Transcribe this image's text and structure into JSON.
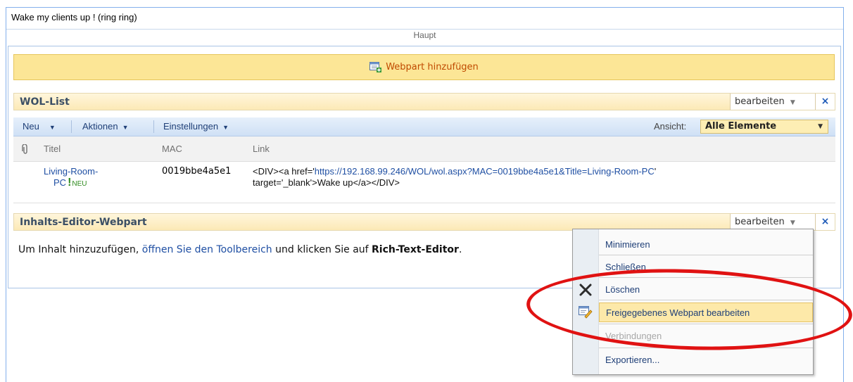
{
  "page": {
    "title": "Wake my clients up ! (ring ring)",
    "zone_label": "Haupt",
    "add_webpart_label": "Webpart hinzufügen"
  },
  "wol_list": {
    "title": "WOL-List",
    "edit_label": "bearbeiten",
    "close_label": "×",
    "toolbar": {
      "new_label": "Neu",
      "actions_label": "Aktionen",
      "settings_label": "Einstellungen",
      "view_label": "Ansicht:",
      "view_value": "Alle Elemente"
    },
    "columns": [
      "Titel",
      "MAC",
      "Link"
    ],
    "rows": [
      {
        "title_line1": "Living-Room-",
        "title_line2": "PC",
        "new_badge": "NEU",
        "mac": "0019bbe4a5e1",
        "link_pre": "<DIV><a href='",
        "link_url": "https://192.168.99.246/WOL/wol.aspx?MAC=0019bbe4a5e1&Title=Living-Room-PC",
        "link_post": "'",
        "link_line2": "target='_blank'>Wake up</a></DIV>"
      }
    ]
  },
  "content_editor": {
    "title": "Inhalts-Editor-Webpart",
    "edit_label": "bearbeiten",
    "close_label": "×",
    "text_before": "Um Inhalt hinzuzufügen, ",
    "link_text": "öffnen Sie den Toolbereich",
    "text_middle": " und klicken Sie auf ",
    "bold_text": "Rich-Text-Editor",
    "text_after": "."
  },
  "context_menu": {
    "items": [
      {
        "label": "Minimieren",
        "disabled": false
      },
      {
        "label": "Schließen",
        "disabled": false
      },
      {
        "label": "Löschen",
        "disabled": false,
        "icon": "delete-x-icon"
      },
      {
        "label": "Freigegebenes Webpart bearbeiten",
        "disabled": false,
        "highlighted": true,
        "icon": "edit-webpart-icon"
      },
      {
        "label": "Verbindungen",
        "disabled": true
      },
      {
        "label": "Exportieren...",
        "disabled": false
      }
    ]
  },
  "colors": {
    "annotation": "#e01212",
    "add_bar": "#fce696",
    "link": "#1f4fa3",
    "new_badge": "#2e8b1e"
  }
}
